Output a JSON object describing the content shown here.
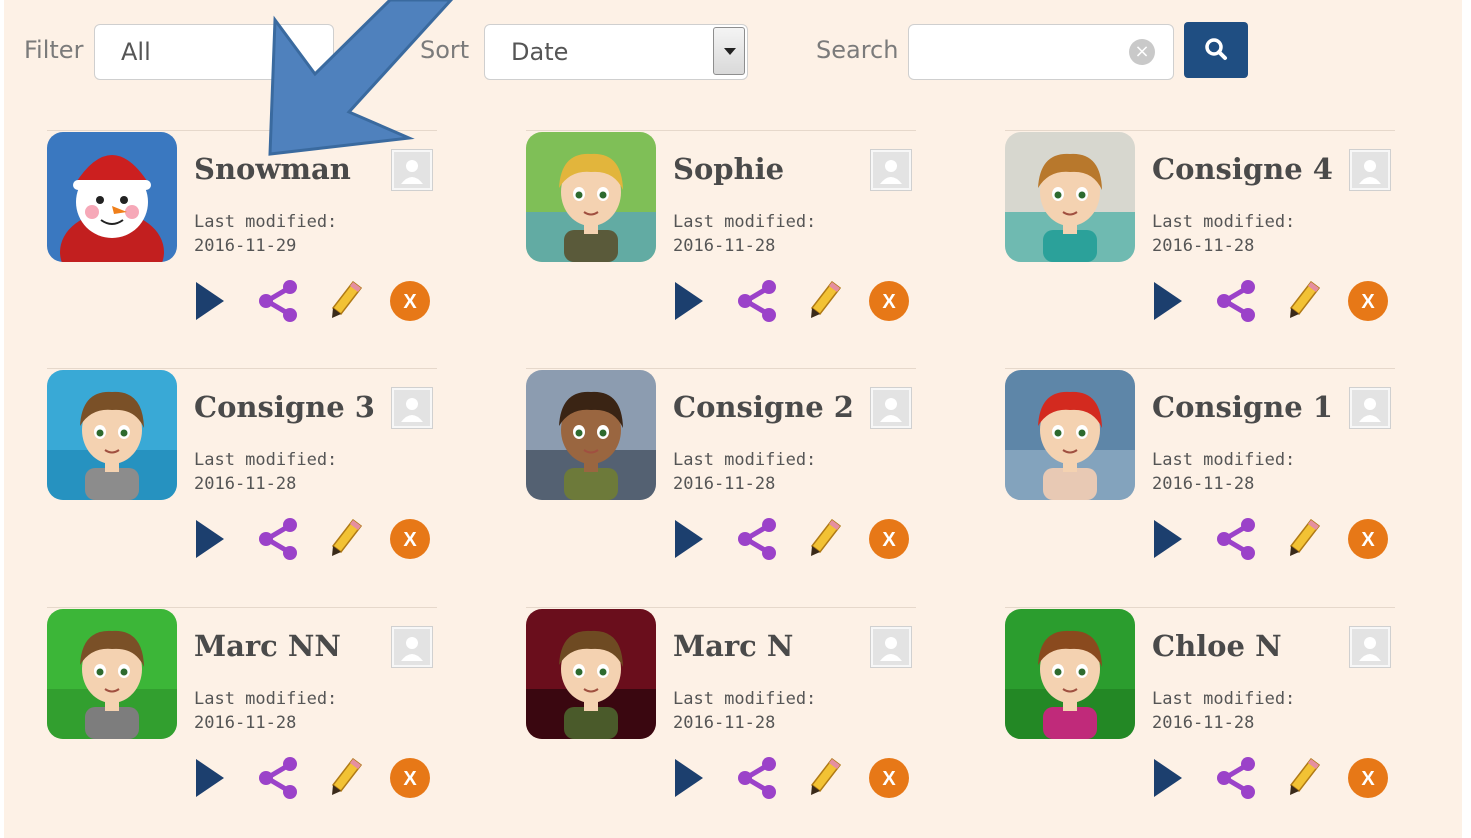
{
  "toolbar": {
    "filter_label": "Filter",
    "filter_value": "All",
    "sort_label": "Sort",
    "sort_value": "Date",
    "search_label": "Search",
    "search_value": "",
    "search_button_icon": "search-icon"
  },
  "colors": {
    "background": "#fdf1e6",
    "search_button": "#1f4e82",
    "play": "#1c3f6e",
    "share": "#9b42c9",
    "delete": "#e77817",
    "arrow": "#4f81bd"
  },
  "cards": [
    {
      "title": "Snowman",
      "modified_label": "Last modified:",
      "date": "2016-11-29",
      "avatar": "snowman"
    },
    {
      "title": "Sophie",
      "modified_label": "Last modified:",
      "date": "2016-11-28",
      "avatar": "sophie"
    },
    {
      "title": "Consigne 4",
      "modified_label": "Last modified:",
      "date": "2016-11-28",
      "avatar": "consigne4"
    },
    {
      "title": "Consigne 3",
      "modified_label": "Last modified:",
      "date": "2016-11-28",
      "avatar": "consigne3"
    },
    {
      "title": "Consigne 2",
      "modified_label": "Last modified:",
      "date": "2016-11-28",
      "avatar": "consigne2"
    },
    {
      "title": "Consigne 1",
      "modified_label": "Last modified:",
      "date": "2016-11-28",
      "avatar": "consigne1"
    },
    {
      "title": "Marc NN",
      "modified_label": "Last modified:",
      "date": "2016-11-28",
      "avatar": "marcnn"
    },
    {
      "title": "Marc N",
      "modified_label": "Last modified:",
      "date": "2016-11-28",
      "avatar": "marcn"
    },
    {
      "title": "Chloe N",
      "modified_label": "Last modified:",
      "date": "2016-11-28",
      "avatar": "chloen"
    }
  ],
  "card_actions": [
    "play-icon",
    "share-icon",
    "pencil-icon",
    "delete-icon"
  ],
  "delete_glyph": "X",
  "annotation": "arrow pointing to first card title"
}
